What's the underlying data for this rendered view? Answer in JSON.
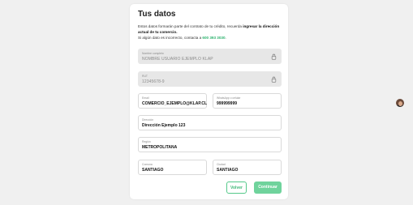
{
  "form": {
    "title": "Tus datos",
    "intro_prefix": "Estos datos formarán parte del contrato de tu crédito, recuerda ",
    "intro_bold": "ingresar la dirección actual de tu comercio.",
    "intro_line2_prefix": "Si algún dato es incorrecto, contacta a ",
    "intro_phone": "600 393 3030",
    "intro_line2_suffix": "."
  },
  "fields": {
    "name": {
      "label": "Nombre completo",
      "value": "NOMBRE USUARIO EJEMPLO KLAP",
      "disabled": true
    },
    "rut": {
      "label": "RUT",
      "value": "12345678-9",
      "disabled": true
    },
    "email": {
      "label": "Email",
      "value": "COMERCIO_EJEMPLO@KLAP.CL"
    },
    "whatsapp": {
      "label": "WhatsApp o celular",
      "value": "999999999"
    },
    "address": {
      "label": "Dirección",
      "value": "Dirección Ejemplo 123"
    },
    "region": {
      "label": "Región",
      "value": "METROPOLITANA"
    },
    "comuna": {
      "label": "Comuna",
      "value": "SANTIAGO"
    },
    "city": {
      "label": "Ciudad",
      "value": "SANTIAGO"
    }
  },
  "buttons": {
    "back": "Volver",
    "next": "Continuar"
  },
  "icons": {
    "lock": "lock-icon",
    "avatar": "user-avatar"
  },
  "colors": {
    "accent": "#3fb877",
    "accent_fill": "#6fd39c",
    "disabled_field": "#e7e7e7"
  }
}
